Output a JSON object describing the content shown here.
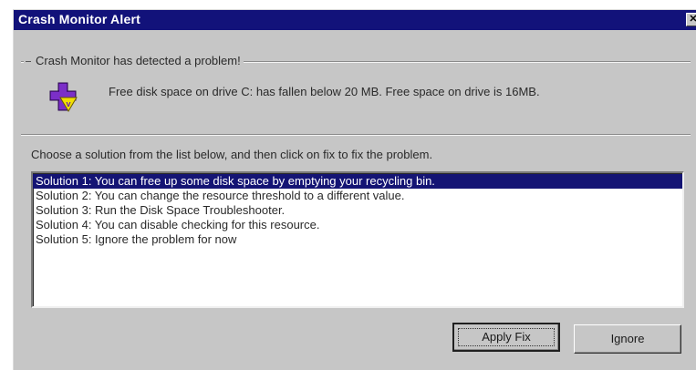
{
  "window": {
    "title": "Crash Monitor Alert",
    "close_glyph": "✕"
  },
  "group": {
    "label": "Crash Monitor has detected a problem!",
    "icon": "disk-warning-icon",
    "message": "Free disk space on drive C: has fallen below 20 MB.  Free space on drive is 16MB."
  },
  "instruction": "Choose a solution from the list below, and then click on fix to fix the problem.",
  "solutions": [
    {
      "label": "Solution 1: You can free up some disk space by emptying your recycling bin.",
      "selected": true
    },
    {
      "label": "Solution 2: You can change the resource threshold to a different value.",
      "selected": false
    },
    {
      "label": "Solution 3: Run the Disk Space Troubleshooter.",
      "selected": false
    },
    {
      "label": "Solution 4: You can disable checking for this resource.",
      "selected": false
    },
    {
      "label": "Solution 5: Ignore the problem for now",
      "selected": false
    }
  ],
  "buttons": {
    "apply": "Apply Fix",
    "ignore": "Ignore"
  },
  "colors": {
    "titlebar": "#12127a",
    "selection": "#141474",
    "face": "#c6c6c6"
  }
}
